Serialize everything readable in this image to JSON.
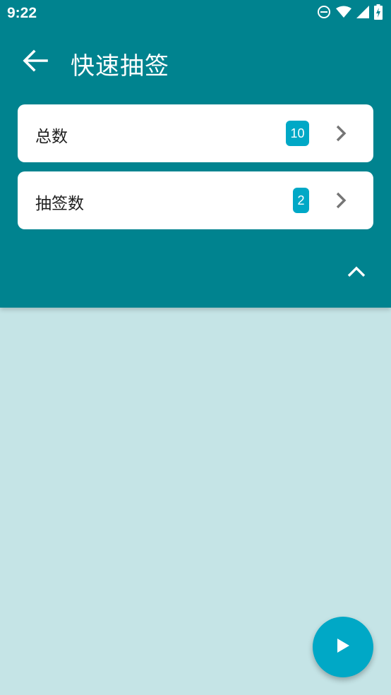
{
  "status_bar": {
    "time": "9:22",
    "icons": [
      "do-not-disturb-icon",
      "wifi-icon",
      "signal-icon",
      "battery-charging-icon"
    ]
  },
  "app_bar": {
    "title": "快速抽签",
    "back_icon": "arrow-left-icon"
  },
  "settings": [
    {
      "label": "总数",
      "value": "10"
    },
    {
      "label": "抽签数",
      "value": "2"
    }
  ],
  "colors": {
    "primary": "#00838f",
    "accent": "#00a8c6",
    "background": "#c5e4e6",
    "card": "#ffffff"
  },
  "collapse_icon": "chevron-up-icon",
  "fab_icon": "play-icon"
}
